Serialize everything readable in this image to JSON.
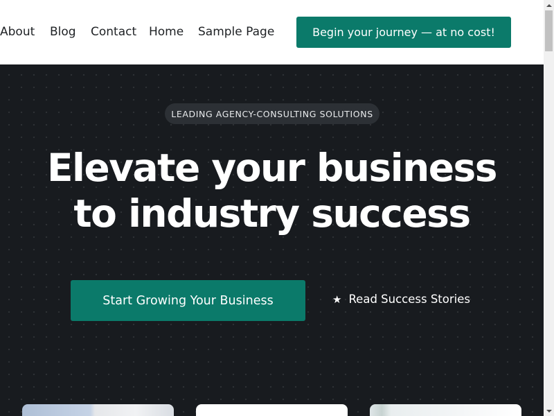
{
  "nav": {
    "items": [
      {
        "label": "About"
      },
      {
        "label": "Blog"
      },
      {
        "label": "Contact"
      },
      {
        "label": "Home"
      },
      {
        "label": "Sample Page"
      }
    ],
    "cta_label": "Begin your journey — at no cost!"
  },
  "hero": {
    "eyebrow": "LEADING AGENCY-CONSULTING SOLUTIONS",
    "headline_line1": "Elevate your business",
    "headline_line2": "to industry success",
    "primary_button": "Start Growing Your Business",
    "secondary_link": "Read Success Stories",
    "secondary_icon": "star-icon"
  },
  "colors": {
    "accent": "#0b7a6a",
    "hero_bg": "#181b1f",
    "pill_bg": "#2c3035"
  }
}
